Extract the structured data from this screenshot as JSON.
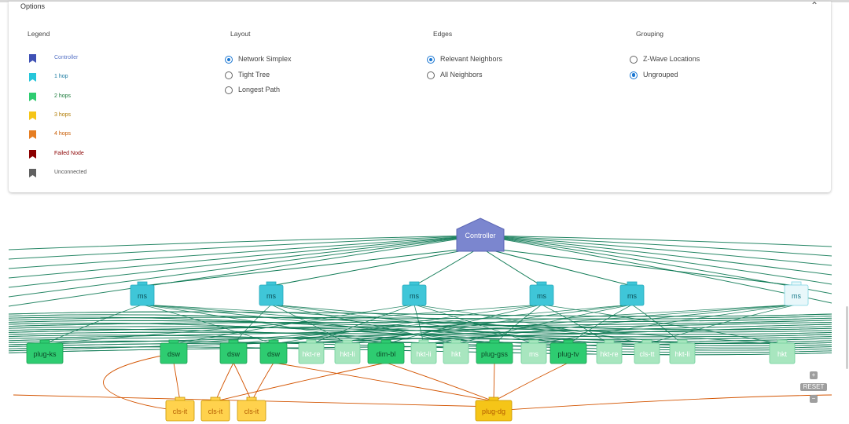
{
  "options": {
    "title": "Options",
    "legend_title": "Legend",
    "layout_title": "Layout",
    "edges_title": "Edges",
    "grouping_title": "Grouping"
  },
  "legend": [
    {
      "label": "Controller",
      "color": "#3f51b5",
      "text_color": "#5a76c7"
    },
    {
      "label": "1 hop",
      "color": "#26c6da",
      "text_color": "#1a7aa0"
    },
    {
      "label": "2 hops",
      "color": "#2ecc71",
      "text_color": "#1a7a3a"
    },
    {
      "label": "3 hops",
      "color": "#f5c518",
      "text_color": "#b07a00"
    },
    {
      "label": "4 hops",
      "color": "#e67e22",
      "text_color": "#c85a00"
    },
    {
      "label": "Failed Node",
      "color": "#8b0000",
      "text_color": "#8b0000"
    },
    {
      "label": "Unconnected",
      "color": "#616161",
      "text_color": "#555555"
    }
  ],
  "layout_options": [
    {
      "label": "Network Simplex",
      "selected": true
    },
    {
      "label": "Tight Tree",
      "selected": false
    },
    {
      "label": "Longest Path",
      "selected": false
    }
  ],
  "edge_options": [
    {
      "label": "Relevant Neighbors",
      "selected": true
    },
    {
      "label": "All Neighbors",
      "selected": false
    }
  ],
  "grouping_options": [
    {
      "label": "Z-Wave Locations",
      "selected": false
    },
    {
      "label": "Ungrouped",
      "selected": true
    }
  ],
  "graph": {
    "controller": "Controller",
    "hop1": [
      "ms",
      "ms",
      "ms",
      "ms",
      "ms",
      "ms"
    ],
    "hop2": [
      "plug-ks",
      "dsw",
      "dsw",
      "dsw",
      "hkt-re",
      "hkt-li",
      "dim-bl",
      "hkt-li",
      "hkt",
      "plug-gss",
      "ms",
      "plug-tv",
      "hkt-re",
      "cls-tt",
      "hkt-li",
      "hkt"
    ],
    "hop3": [
      "cls-it",
      "cls-it",
      "cls-it",
      "plug-dg"
    ]
  },
  "zoom": {
    "in": "+",
    "reset": "RESET",
    "out": "−"
  }
}
